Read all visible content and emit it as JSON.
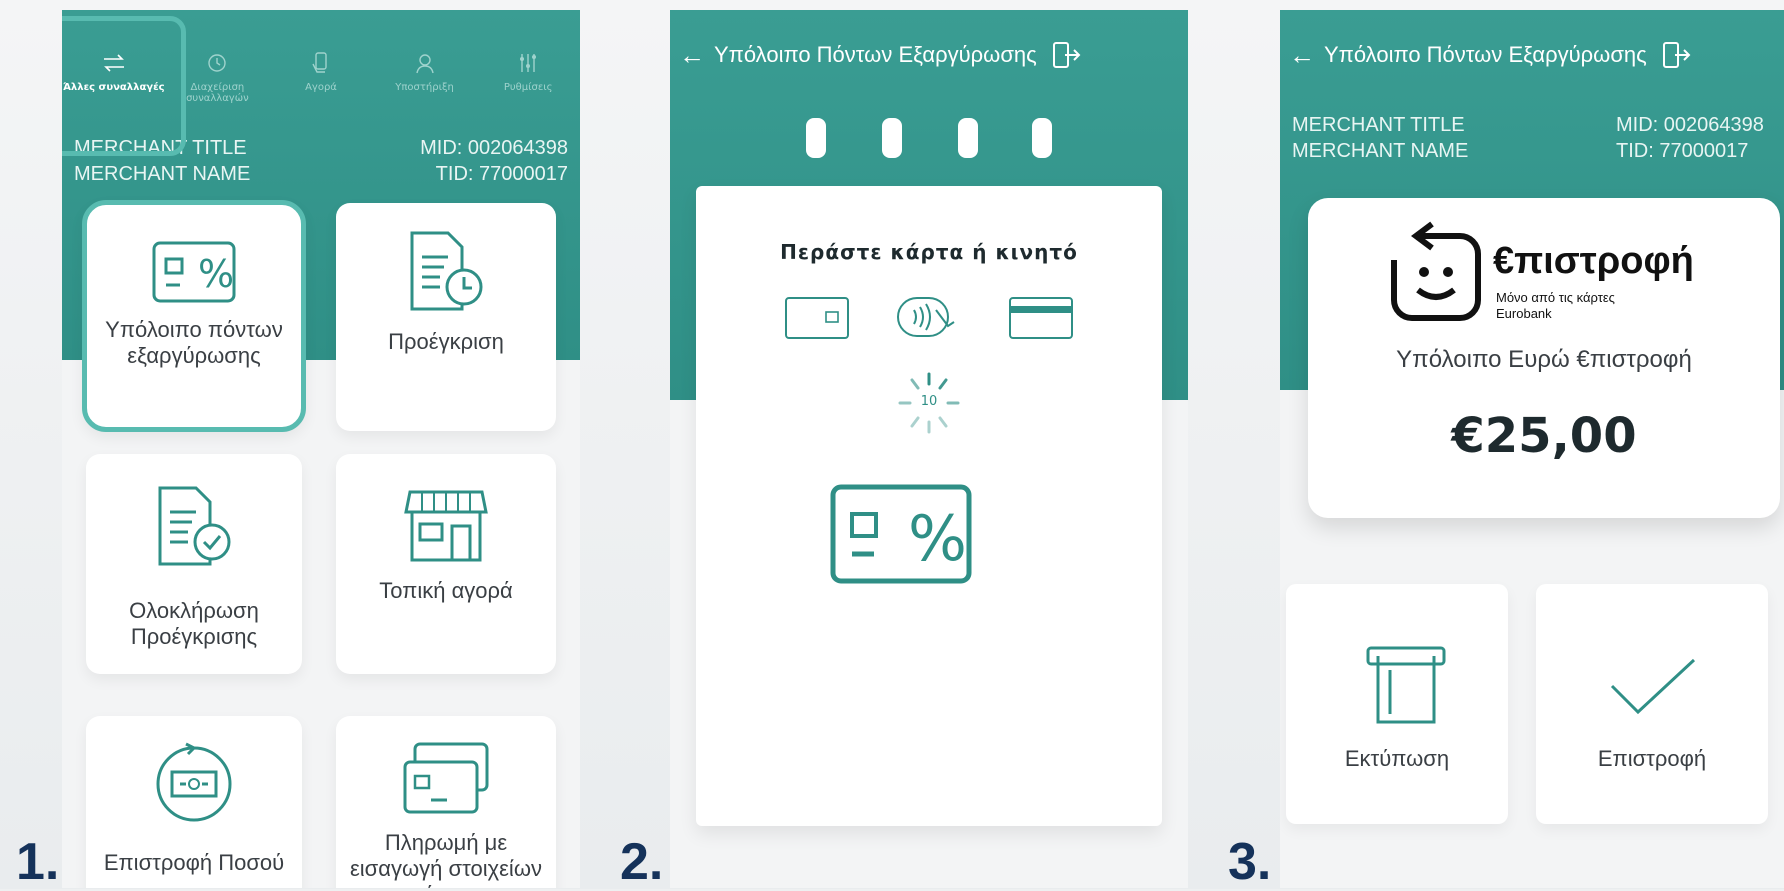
{
  "steps": [
    "1.",
    "2.",
    "3."
  ],
  "screen1": {
    "nav": [
      {
        "label": "Άλλες συναλλαγές",
        "icon": "arrows-exchange-icon"
      },
      {
        "label": "Διαχείριση συναλλαγών",
        "icon": "clock-icon"
      },
      {
        "label": "Αγορά",
        "icon": "hand-card-icon"
      },
      {
        "label": "Υποστήριξη",
        "icon": "support-agent-icon"
      },
      {
        "label": "Ρυθμίσεις",
        "icon": "sliders-icon"
      }
    ],
    "merchant_title": "MERCHANT TITLE",
    "merchant_name": "MERCHANT NAME",
    "mid": "MID: 002064398",
    "tid": "TID: 77000017",
    "tiles": [
      {
        "label": "Υπόλοιπο πόντων εξαργύρωσης",
        "icon": "percent-card-icon"
      },
      {
        "label": "Προέγκριση",
        "icon": "document-clock-icon"
      },
      {
        "label": "Ολοκλήρωση Προέγκρισης",
        "icon": "document-check-icon"
      },
      {
        "label": "Τοπική αγορά",
        "icon": "shop-icon"
      },
      {
        "label": "Επιστροφή Ποσού",
        "icon": "refund-cash-icon"
      },
      {
        "label": "Πληρωμή με εισαγωγή στοιχείων κάρτας",
        "icon": "card-entry-icon"
      }
    ]
  },
  "screen2": {
    "title": "Υπόλοιπο Πόντων Εξαργύρωσης",
    "prompt": "Περάστε κάρτα ή κινητό",
    "countdown": "10"
  },
  "screen3": {
    "title": "Υπόλοιπο Πόντων Εξαργύρωσης",
    "merchant_title": "MERCHANT TITLE",
    "merchant_name": "MERCHANT NAME",
    "mid": "MID: 002064398",
    "tid": "TID: 77000017",
    "brand_title": "€πιστροφή",
    "brand_sub1": "Μόνο από τις κάρτες",
    "brand_sub2": "Eurobank",
    "balance_label": "Υπόλοιπο Ευρώ €πιστροφή",
    "balance_amount": "€25,00",
    "actions": [
      {
        "label": "Εκτύπωση",
        "icon": "print-icon"
      },
      {
        "label": "Επιστροφή",
        "icon": "check-icon"
      }
    ]
  },
  "colors": {
    "teal": "#3a9d93",
    "highlight": "#58bbb0",
    "step_number": "#15325a"
  }
}
